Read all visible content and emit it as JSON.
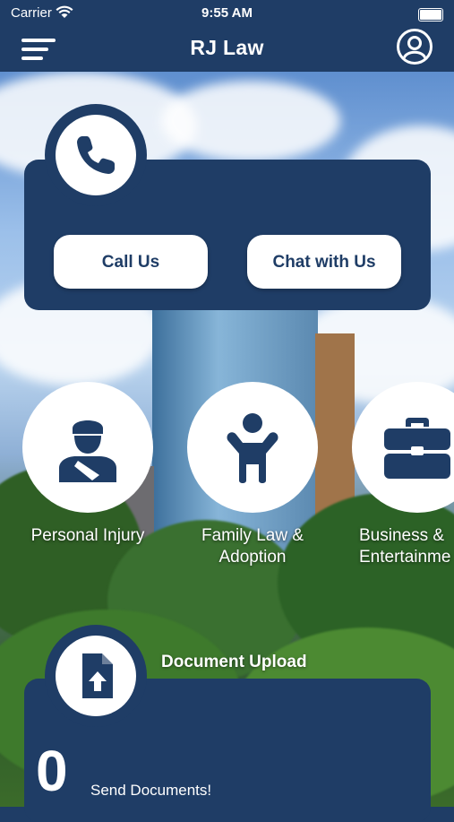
{
  "status_bar": {
    "carrier": "Carrier",
    "time": "9:55 AM"
  },
  "nav": {
    "title": "RJ Law"
  },
  "contact": {
    "call_label": "Call Us",
    "chat_label": "Chat with Us"
  },
  "practice_areas": [
    {
      "label": "Personal Injury",
      "icon": "injured-person-icon"
    },
    {
      "label": "Family Law &\nAdoption",
      "icon": "child-icon"
    },
    {
      "label": "Business &\nEntertainme",
      "icon": "briefcase-icon"
    }
  ],
  "documents": {
    "title": "Document Upload",
    "count": "0",
    "subtitle": "Send Documents!"
  },
  "colors": {
    "brand": "#1f3d66",
    "surface": "#ffffff"
  }
}
